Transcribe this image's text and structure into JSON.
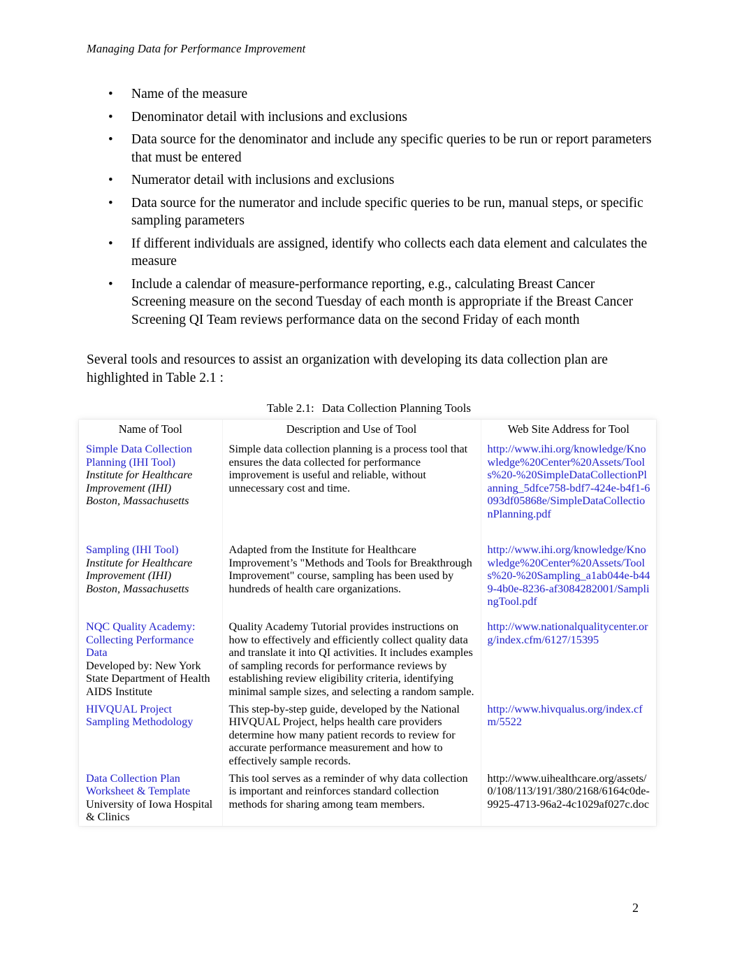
{
  "document": {
    "running_header": "Managing Data for Performance Improvement",
    "page_number": "2"
  },
  "bullets": [
    "Name of the measure",
    "Denominator detail with inclusions and exclusions",
    "Data source for the denominator and include any specific queries to be run or report parameters that must be entered",
    "Numerator detail with inclusions and exclusions",
    "Data source for the numerator and include specific queries to be run, manual steps, or specific sampling parameters",
    "If different individuals are assigned, identify who collects each data element and calculates the measure",
    "Include a calendar of measure-performance reporting, e.g., calculating Breast Cancer Screening measure on the second Tuesday of each month is appropriate if the Breast Cancer Screening QI Team reviews performance data on the second Friday of each month"
  ],
  "bullet_marker": "•",
  "intro_paragraph": "Several tools and resources to assist an organization with developing its data collection plan are highlighted in Table 2.1 :",
  "table": {
    "caption_label": "Table 2.1:",
    "caption_title": "Data Collection Planning Tools",
    "headers": [
      "Name of Tool",
      "Description and Use of Tool",
      "Web Site Address for Tool"
    ],
    "rows": [
      {
        "tool_name": "Simple Data Collection Planning (IHI Tool)",
        "org_line1": "Institute for Healthcare",
        "org_line2": "Improvement (IHI)",
        "org_line3": "Boston, Massachusetts",
        "org_italic": true,
        "description": "Simple data collection planning is a process tool that ensures the data collected for performance improvement is useful and reliable, without unnecessary cost and time.",
        "url": "http://www.ihi.org/knowledge/Knowledge%20Center%20Assets/Tools%20-%20SimpleDataCollectionPlanning_5dfce758-bdf7-424e-b4f1-6093df05868e/SimpleDataCollectionPlanning.pdf",
        "url_is_link": true
      },
      {
        "tool_name": "Sampling (IHI Tool)",
        "org_line1": "Institute for Healthcare",
        "org_line2": "Improvement (IHI)",
        "org_line3": "Boston, Massachusetts",
        "org_italic": true,
        "description": "Adapted from the Institute for Healthcare Improvement’s \"Methods and Tools for Breakthrough Improvement\" course, sampling has been used by hundreds of health care organizations.",
        "url": "http://www.ihi.org/knowledge/Knowledge%20Center%20Assets/Tools%20-%20Sampling_a1ab044e-b449-4b0e-8236-af3084282001/SamplingTool.pdf",
        "url_is_link": true
      },
      {
        "tool_name": "NQC Quality Academy: Collecting Performance Data",
        "org_line1": "Developed by: New York",
        "org_line2": "State Department of Health",
        "org_line3": "AIDS Institute",
        "org_italic": false,
        "description": "Quality Academy Tutorial provides instructions on how to effectively and efficiently collect quality data and translate it into QI activities.  It includes examples of sampling records for performance reviews by establishing review eligibility criteria, identifying minimal sample sizes, and selecting a random sample.",
        "url": "http://www.nationalqualitycenter.org/index.cfm/6127/15395",
        "url_is_link": true
      },
      {
        "tool_name": "HIVQUAL Project Sampling Methodology",
        "org_line1": "",
        "org_line2": "",
        "org_line3": "",
        "org_italic": false,
        "description": "This step-by-step guide, developed by the National HIVQUAL Project, helps health care providers determine how many patient records to review for accurate performance measurement and how to effectively sample records.",
        "url": "http://www.hivqualus.org/index.cfm/5522",
        "url_is_link": true
      },
      {
        "tool_name": "Data Collection Plan Worksheet & Template",
        "org_line1": "University of Iowa Hospital",
        "org_line2": "& Clinics",
        "org_line3": "",
        "org_italic": false,
        "description": "This tool serves as a reminder of why data collection is important and reinforces standard collection methods for sharing among team members.",
        "url": "http://www.uihealthcare.org/assets/0/108/113/191/380/2168/6164c0de-9925-4713-96a2-4c1029af027c.doc",
        "url_is_link": false
      }
    ]
  },
  "colors": {
    "link": "#2222cc",
    "text": "#000000",
    "page_background": "#ffffff"
  }
}
